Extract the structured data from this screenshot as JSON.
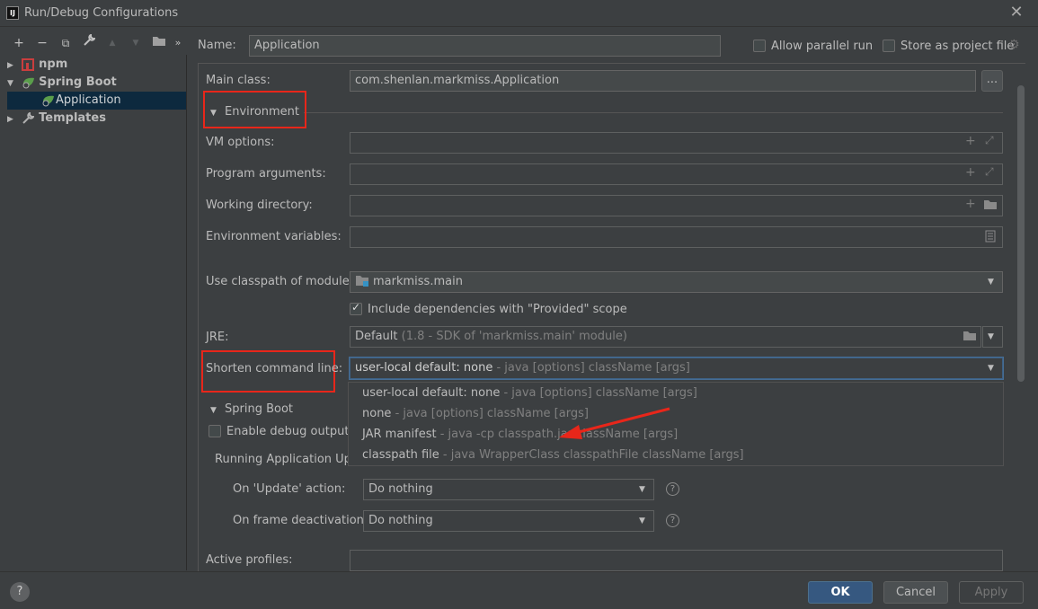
{
  "window": {
    "title": "Run/Debug Configurations",
    "close_glyph": "✕",
    "app_icon_text": "IJ"
  },
  "toolbar": {
    "add": "+",
    "remove": "−",
    "copy": "⧉",
    "edit": "🔧",
    "up": "▲",
    "down": "▼",
    "folder": "📁",
    "more": "»"
  },
  "tree": {
    "items": [
      {
        "label": "npm",
        "icon": "npm-icon"
      },
      {
        "label": "Spring Boot",
        "icon": "spring-boot-icon"
      },
      {
        "label": "Application",
        "icon": "spring-boot-app-icon"
      },
      {
        "label": "Templates",
        "icon": "wrench-icon"
      }
    ]
  },
  "header": {
    "name_label": "Name:",
    "name_value": "Application",
    "allow_parallel": "Allow parallel run",
    "store_project": "Store as project file"
  },
  "form": {
    "main_class_label": "Main class:",
    "main_class_value": "com.shenlan.markmiss.Application",
    "browse": "...",
    "environment": "Environment",
    "vm_options": "VM options:",
    "program_args": "Program arguments:",
    "working_dir": "Working directory:",
    "env_vars": "Environment variables:",
    "classpath_label": "Use classpath of module:",
    "classpath_value": "markmiss.main",
    "include_deps": "Include dependencies with \"Provided\" scope",
    "jre_label": "JRE:",
    "jre_value": "Default",
    "jre_hint": "(1.8 - SDK of 'markmiss.main' module)",
    "shorten_label": "Shorten command line:",
    "shorten_value": "user-local default: none",
    "shorten_hint": " - java [options] className [args]",
    "spring_boot": "Spring Boot",
    "enable_debug": "Enable debug output",
    "running_update": "Running Application Upda",
    "on_update_label": "On 'Update' action:",
    "on_update_value": "Do nothing",
    "on_frame_label": "On frame deactivation:",
    "on_frame_value": "Do nothing",
    "active_profiles": "Active profiles:"
  },
  "popup": {
    "items": [
      {
        "main": "user-local default: none",
        "hint": " - java [options] className [args]"
      },
      {
        "main": "none",
        "hint": " - java [options] className [args]"
      },
      {
        "main": "JAR manifest",
        "hint": " - java -cp classpath.jar className [args]"
      },
      {
        "main": "classpath file",
        "hint": " - java WrapperClass classpathFile className [args]"
      }
    ]
  },
  "buttons": {
    "ok": "OK",
    "cancel": "Cancel",
    "apply": "Apply",
    "help": "?"
  },
  "colors": {
    "background": "#3c3f41",
    "selection": "#0d293e",
    "accent": "#365880",
    "annotation": "#e8261a"
  }
}
